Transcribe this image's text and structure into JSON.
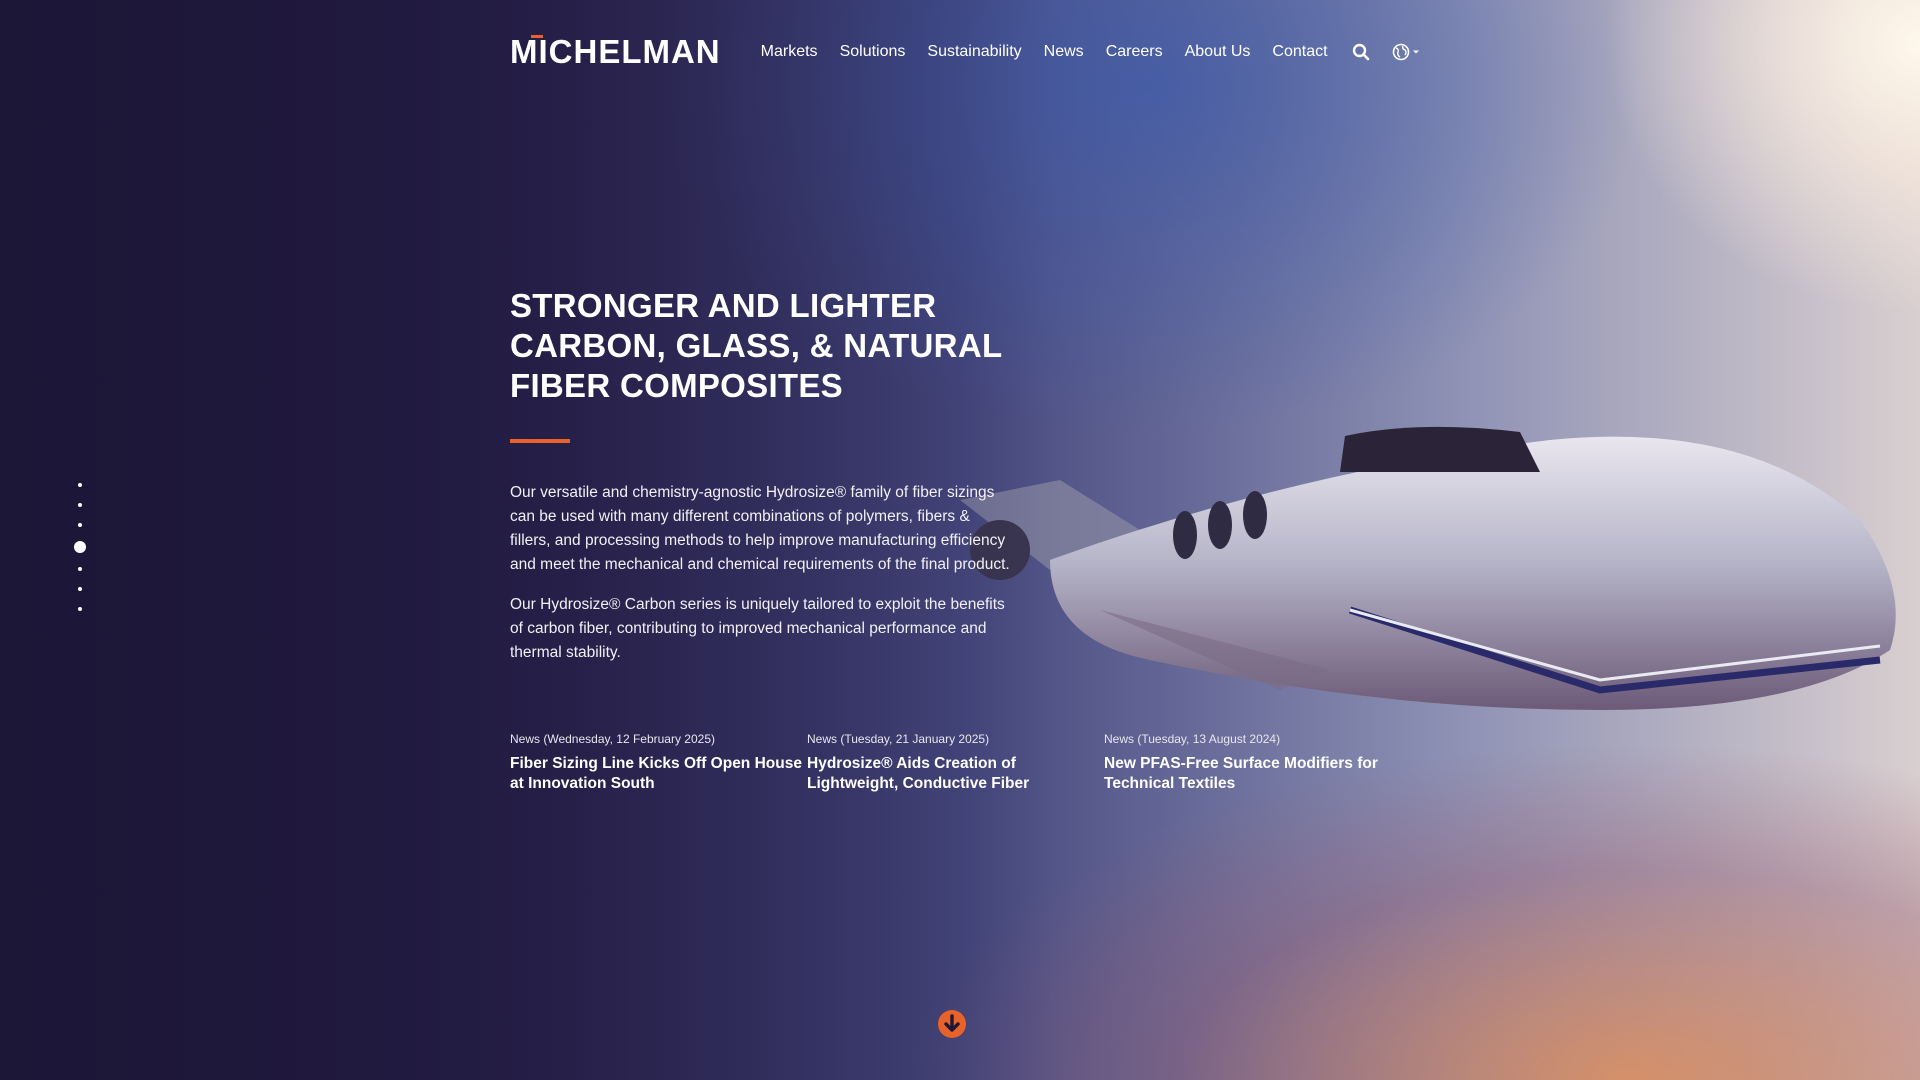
{
  "brand": {
    "logo_text": "MICHELMAN",
    "accent_color": "#e8622a"
  },
  "nav": {
    "items": [
      {
        "label": "Markets"
      },
      {
        "label": "Solutions"
      },
      {
        "label": "Sustainability"
      },
      {
        "label": "News"
      },
      {
        "label": "Careers"
      },
      {
        "label": "About Us"
      },
      {
        "label": "Contact"
      }
    ],
    "icons": [
      "search-icon",
      "globe-icon",
      "caret-down-icon"
    ]
  },
  "hero": {
    "title_lines": [
      "STRONGER AND LIGHTER",
      "CARBON, GLASS, & NATURAL",
      "FIBER COMPOSITES"
    ],
    "paragraphs": [
      "Our versatile and chemistry-agnostic Hydrosize® family of fiber sizings can be used with many different combinations of polymers, fibers & fillers, and processing methods to help improve manufacturing efficiency and meet the mechanical and chemical requirements of the final product.",
      "Our Hydrosize® Carbon series is uniquely tailored to exploit the benefits of carbon fiber, contributing to improved mechanical performance and thermal stability."
    ]
  },
  "news": [
    {
      "meta": "News (Wednesday, 12 February 2025)",
      "title": "Fiber Sizing Line Kicks Off Open House at Innovation South"
    },
    {
      "meta": "News (Tuesday, 21 January 2025)",
      "title": "Hydrosize® Aids Creation of Lightweight, Conductive Fiber"
    },
    {
      "meta": "News (Tuesday, 13 August 2024)",
      "title": "New PFAS-Free Surface Modifiers for Technical Textiles"
    }
  ],
  "slide_pager": {
    "count": 7,
    "active_index": 3
  },
  "scroll_icon": "arrow-down-circle-icon"
}
